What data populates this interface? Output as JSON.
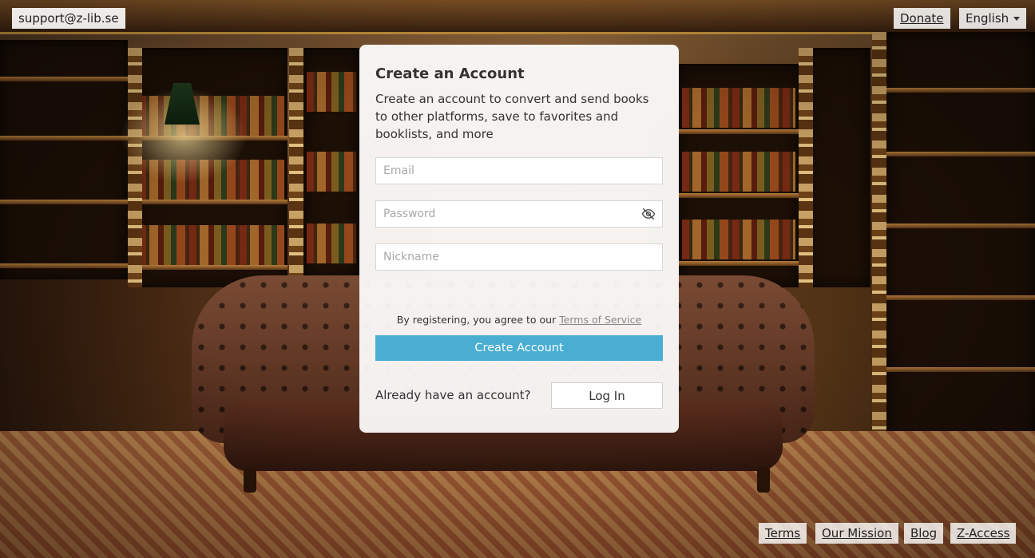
{
  "top_bar": {
    "support_email": "support@z-lib.se",
    "donate_label": "Donate",
    "language": "English"
  },
  "card": {
    "title": "Create an Account",
    "description": "Create an account to convert and send books to other platforms, save to favorites and booklists, and more",
    "email_placeholder": "Email",
    "password_placeholder": "Password",
    "nickname_placeholder": "Nickname",
    "terms_prefix": "By registering, you agree to our ",
    "terms_link": "Terms of Service",
    "create_button": "Create Account",
    "already_text": "Already have an account?",
    "login_button": "Log In"
  },
  "footer": {
    "links": [
      "Terms",
      "Our Mission",
      "Blog",
      "Z-Access"
    ]
  },
  "colors": {
    "primary_button": "#49aed2",
    "card_background": "#ffffff"
  }
}
